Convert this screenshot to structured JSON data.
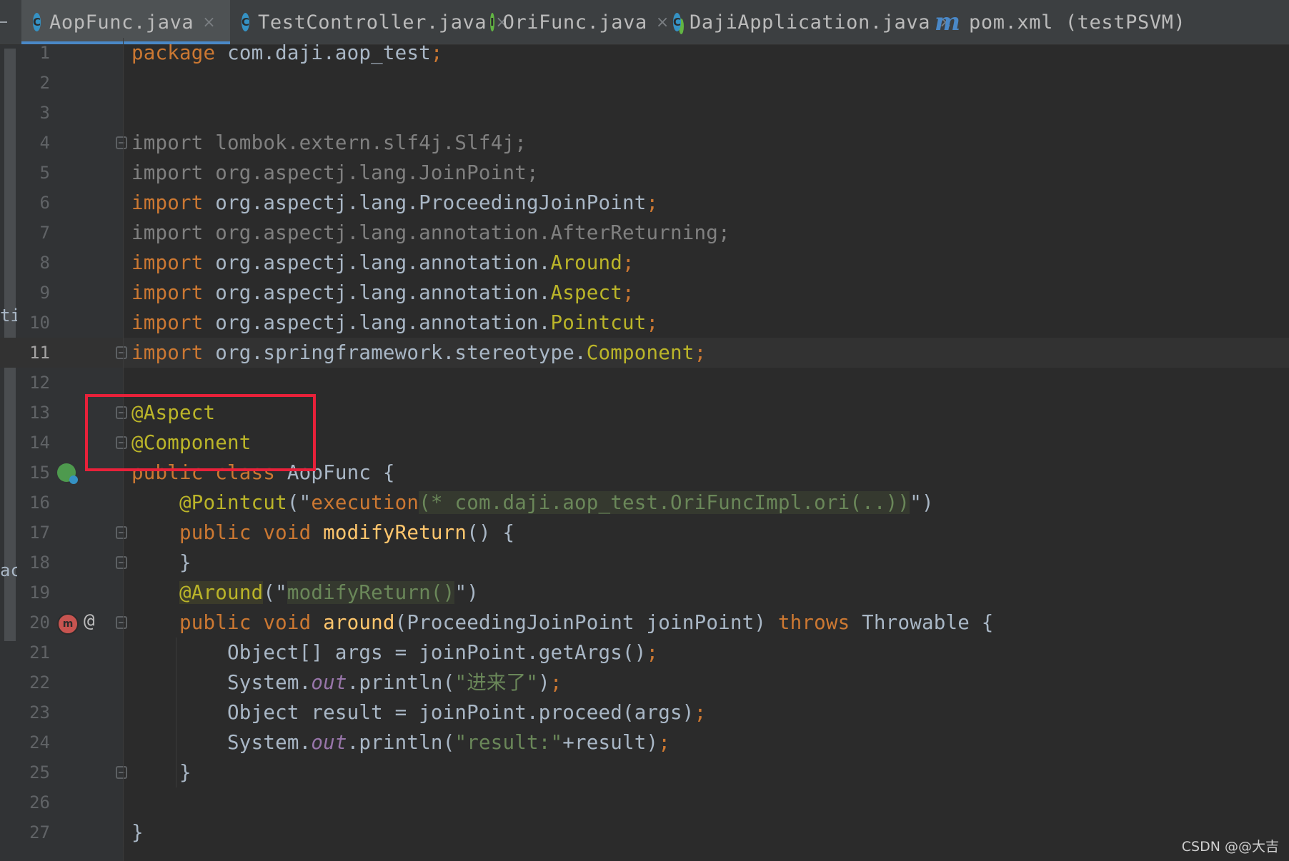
{
  "tabs": [
    {
      "label": "AopFunc.java",
      "icon": "java-class-icon",
      "active": true
    },
    {
      "label": "TestController.java",
      "icon": "java-class-icon",
      "active": false
    },
    {
      "label": "OriFunc.java",
      "icon": "java-interface-icon",
      "active": false
    },
    {
      "label": "DajiApplication.java",
      "icon": "spring-boot-app-icon",
      "active": false
    },
    {
      "label": "pom.xml (testPSVM)",
      "icon": "maven-icon",
      "active": false
    }
  ],
  "tab_icon_letters": {
    "class": "C",
    "interface": "I",
    "maven": "m"
  },
  "left_strip": {
    "glyph_11": "ti",
    "glyph_21": "ac"
  },
  "gutter": {
    "at_symbol": "@"
  },
  "current_line": 11,
  "highlighted_lines": [
    13,
    14
  ],
  "code_lines": [
    [
      {
        "t": "package ",
        "c": "kw"
      },
      {
        "t": "com.daji.aop_test",
        "c": "plain"
      },
      {
        "t": ";",
        "c": "kw"
      }
    ],
    [],
    [],
    [
      {
        "t": "import lombok.extern.slf4j.Slf4j;",
        "c": "dim"
      }
    ],
    [
      {
        "t": "import org.aspectj.lang.JoinPoint;",
        "c": "dim"
      }
    ],
    [
      {
        "t": "import ",
        "c": "kw"
      },
      {
        "t": "org.aspectj.lang.ProceedingJoinPoint",
        "c": "plain"
      },
      {
        "t": ";",
        "c": "kw"
      }
    ],
    [
      {
        "t": "import org.aspectj.lang.annotation.AfterReturning;",
        "c": "dim"
      }
    ],
    [
      {
        "t": "import ",
        "c": "kw"
      },
      {
        "t": "org.aspectj.lang.annotation.",
        "c": "plain"
      },
      {
        "t": "Around",
        "c": "ann"
      },
      {
        "t": ";",
        "c": "kw"
      }
    ],
    [
      {
        "t": "import ",
        "c": "kw"
      },
      {
        "t": "org.aspectj.lang.annotation.",
        "c": "plain"
      },
      {
        "t": "Aspect",
        "c": "ann"
      },
      {
        "t": ";",
        "c": "kw"
      }
    ],
    [
      {
        "t": "import ",
        "c": "kw"
      },
      {
        "t": "org.aspectj.lang.annotation.",
        "c": "plain"
      },
      {
        "t": "Pointcut",
        "c": "ann"
      },
      {
        "t": ";",
        "c": "kw"
      }
    ],
    [
      {
        "t": "import ",
        "c": "kw"
      },
      {
        "t": "org.springframework.stereotype.",
        "c": "plain"
      },
      {
        "t": "Component",
        "c": "ann"
      },
      {
        "t": ";",
        "c": "kw"
      }
    ],
    [],
    [
      {
        "t": "@Aspect",
        "c": "ann"
      }
    ],
    [
      {
        "t": "@Component",
        "c": "ann"
      }
    ],
    [
      {
        "t": "public class ",
        "c": "kw"
      },
      {
        "t": "AopFunc {",
        "c": "plain"
      }
    ],
    [
      {
        "t": "    ",
        "c": "plain"
      },
      {
        "t": "@Pointcut",
        "c": "ann"
      },
      {
        "t": "(\"",
        "c": "plain"
      },
      {
        "t": "execution",
        "c": "kw"
      },
      {
        "t": "(* com.daji.aop_test.OriFuncImpl.ori(..))",
        "c": "strbg"
      },
      {
        "t": "\")",
        "c": "plain"
      }
    ],
    [
      {
        "t": "    ",
        "c": "plain"
      },
      {
        "t": "public void ",
        "c": "kw"
      },
      {
        "t": "modifyReturn",
        "c": "fn"
      },
      {
        "t": "() {",
        "c": "plain"
      }
    ],
    [
      {
        "t": "    }",
        "c": "plain"
      }
    ],
    [
      {
        "t": "    ",
        "c": "plain"
      },
      {
        "t": "@Around",
        "c": "annbg"
      },
      {
        "t": "(\"",
        "c": "plain"
      },
      {
        "t": "modifyReturn()",
        "c": "strbg"
      },
      {
        "t": "\")",
        "c": "plain"
      }
    ],
    [
      {
        "t": "    ",
        "c": "plain"
      },
      {
        "t": "public void ",
        "c": "kw"
      },
      {
        "t": "around",
        "c": "fn"
      },
      {
        "t": "(ProceedingJoinPoint joinPoint) ",
        "c": "plain"
      },
      {
        "t": "throws ",
        "c": "kw"
      },
      {
        "t": "Throwable {",
        "c": "plain"
      }
    ],
    [
      {
        "t": "        Object[] args = joinPoint.getArgs()",
        "c": "plain"
      },
      {
        "t": ";",
        "c": "kw"
      }
    ],
    [
      {
        "t": "        System.",
        "c": "plain"
      },
      {
        "t": "out",
        "c": "static"
      },
      {
        "t": ".println(",
        "c": "plain"
      },
      {
        "t": "\"进来了\"",
        "c": "str"
      },
      {
        "t": ")",
        "c": "plain"
      },
      {
        "t": ";",
        "c": "kw"
      }
    ],
    [
      {
        "t": "        Object result = joinPoint.proceed(args)",
        "c": "plain"
      },
      {
        "t": ";",
        "c": "kw"
      }
    ],
    [
      {
        "t": "        System.",
        "c": "plain"
      },
      {
        "t": "out",
        "c": "static"
      },
      {
        "t": ".println(",
        "c": "plain"
      },
      {
        "t": "\"result:\"",
        "c": "str"
      },
      {
        "t": "+result)",
        "c": "plain"
      },
      {
        "t": ";",
        "c": "kw"
      }
    ],
    [
      {
        "t": "    }",
        "c": "plain"
      }
    ],
    [],
    [
      {
        "t": "}",
        "c": "plain"
      }
    ]
  ],
  "line_numbers": [
    "1",
    "2",
    "3",
    "4",
    "5",
    "6",
    "7",
    "8",
    "9",
    "10",
    "11",
    "12",
    "13",
    "14",
    "15",
    "16",
    "17",
    "18",
    "19",
    "20",
    "21",
    "22",
    "23",
    "24",
    "25",
    "26",
    "27"
  ],
  "watermark": "CSDN @@大吉",
  "colors": {
    "keyword": "#cc7832",
    "annotation": "#bbb529",
    "string": "#6a8759",
    "method": "#ffc66d",
    "highlight_box": "#e8213a",
    "active_tab_underline": "#4a88c7"
  }
}
